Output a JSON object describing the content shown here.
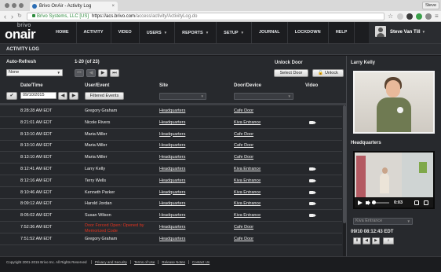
{
  "browser": {
    "tab_title": "Brivo OnAir - Activity Log",
    "profile_label": "Steve",
    "ev_label": "Brivo Systems, LLC [US]",
    "url_scheme_host": "https://acs.brivo.com",
    "url_path": "/access/activity/ActivityLog.do"
  },
  "header": {
    "logo_top": "brivo",
    "logo_main": "onair",
    "menu": [
      {
        "label": "HOME",
        "has_caret": false
      },
      {
        "label": "ACTIVITY",
        "has_caret": false
      },
      {
        "label": "VIDEO",
        "has_caret": false
      },
      {
        "label": "USERS",
        "has_caret": true
      },
      {
        "label": "REPORTS",
        "has_caret": true
      },
      {
        "label": "SETUP",
        "has_caret": true
      },
      {
        "label": "JOURNAL",
        "has_caret": false
      },
      {
        "label": "LOCKDOWN",
        "has_caret": false
      },
      {
        "label": "HELP",
        "has_caret": false
      }
    ],
    "user_name": "Steve Van Till"
  },
  "page_title": "ACTIVITY LOG",
  "controls": {
    "auto_refresh_label": "Auto-Refresh",
    "auto_refresh_value": "None",
    "paging_text": "1-20 (of 23)",
    "unlock_door_label": "Unlock Door",
    "select_door_button": "Select Door",
    "unlock_button": "Unlock",
    "date_time_label": "Date/Time",
    "date_value": "09/10/2015",
    "user_event_label": "User/Event",
    "filtered_events_button": "Filtered Events",
    "site_label": "Site",
    "door_device_label": "Door/Device",
    "video_label": "Video"
  },
  "rows": [
    {
      "time": "8:28:28 AM EDT",
      "user": "Gregory Graham",
      "site": "Headquarters",
      "door": "Cafe Door",
      "video": false,
      "event_alert": false
    },
    {
      "time": "8:21:01 AM EDT",
      "user": "Nicole Rivers",
      "site": "Headquarters",
      "door": "Kiva Entrance",
      "video": true,
      "event_alert": false
    },
    {
      "time": "8:13:10 AM EDT",
      "user": "Maria Miller",
      "site": "Headquarters",
      "door": "Cafe Door",
      "video": false,
      "event_alert": false
    },
    {
      "time": "8:13:10 AM EDT",
      "user": "Maria Miller",
      "site": "Headquarters",
      "door": "Cafe Door",
      "video": false,
      "event_alert": false
    },
    {
      "time": "8:13:10 AM EDT",
      "user": "Maria Miller",
      "site": "Headquarters",
      "door": "Cafe Door",
      "video": false,
      "event_alert": false
    },
    {
      "time": "8:12:41 AM EDT",
      "user": "Larry Kelly",
      "site": "Headquarters",
      "door": "Kiva Entrance",
      "video": true,
      "event_alert": false
    },
    {
      "time": "8:12:16 AM EDT",
      "user": "Terry Wells",
      "site": "Headquarters",
      "door": "Kiva Entrance",
      "video": true,
      "event_alert": false
    },
    {
      "time": "8:10:46 AM EDT",
      "user": "Kenneth Parker",
      "site": "Headquarters",
      "door": "Kiva Entrance",
      "video": true,
      "event_alert": false
    },
    {
      "time": "8:09:12 AM EDT",
      "user": "Harold Jordan",
      "site": "Headquarters",
      "door": "Kiva Entrance",
      "video": true,
      "event_alert": false
    },
    {
      "time": "8:05:02 AM EDT",
      "user": "Susan Wilson",
      "site": "Headquarters",
      "door": "Kiva Entrance",
      "video": true,
      "event_alert": false
    },
    {
      "time": "7:52:36 AM EDT",
      "user": "Door Forced Open: Opened by Memorized Code",
      "site": "Headquarters",
      "door": "Cafe Door",
      "video": false,
      "event_alert": true
    },
    {
      "time": "7:51:52 AM EDT",
      "user": "Gregory Graham",
      "site": "Headquarters",
      "door": "Cafe Door",
      "video": false,
      "event_alert": false
    }
  ],
  "right_panel": {
    "person_name": "Larry Kelly",
    "camera_site": "Headquarters",
    "video_time": "0:03",
    "camera_select": "Kiva Entrance",
    "timestamp": "09/10 08:12:43 EDT",
    "video_progress": 0.1
  },
  "footer": {
    "copyright": "Copyright 2001-2015 Brivo Inc. All Rights Reserved",
    "links": [
      "Privacy and Security",
      "Terms of Use",
      "Release Notes",
      "Contact Us"
    ]
  },
  "colors": {
    "page_bg": "#27292d",
    "header_bg": "#1c1d20",
    "alert_text": "#e0331f",
    "accent_green": "#2e8b3e"
  }
}
